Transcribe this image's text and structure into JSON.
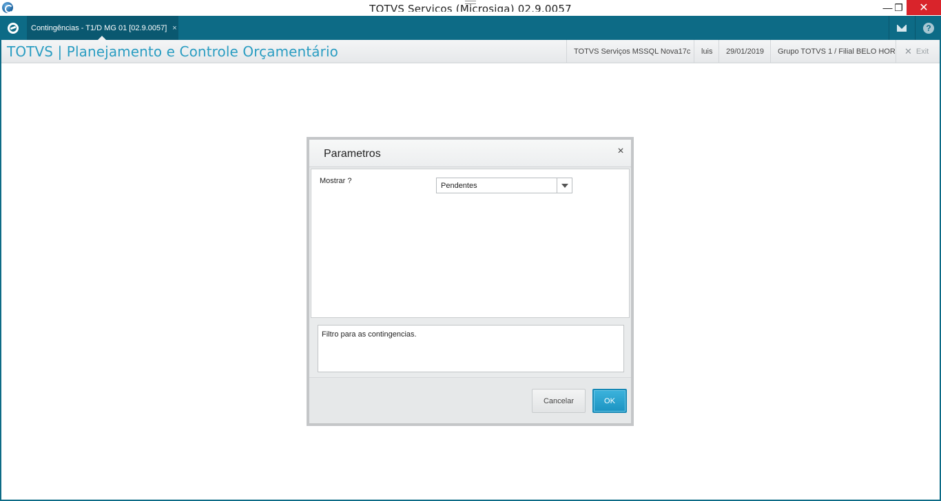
{
  "window": {
    "title": "TOTVS Serviços (Microsiga) 02.9.0057",
    "minimize_glyph": "—",
    "restore_glyph": "❐",
    "close_glyph": "✕"
  },
  "tabbar": {
    "tab_label": "Contingências - T1/D MG 01  [02.9.0057]",
    "tab_close": "×",
    "help_glyph": "?"
  },
  "header": {
    "app_title": "TOTVS | Planejamento e Controle Orçamentário",
    "environment": "TOTVS Serviços MSSQL Nova17c",
    "user": "luis",
    "date": "29/01/2019",
    "company": "Grupo TOTVS 1 / Filial BELO HOR",
    "exit_glyph": "✕",
    "exit_label": "Exit"
  },
  "dialog": {
    "title": "Parametros",
    "close_glyph": "×",
    "fields": [
      {
        "label": "Mostrar ?",
        "value": "Pendentes"
      }
    ],
    "help_text": "Filtro para as contingencias.",
    "cancel_label": "Cancelar",
    "ok_label": "OK"
  },
  "colors": {
    "accent": "#0d6b86",
    "title_blue": "#2a9dc2",
    "ok_button": "#1b93c2",
    "close_red": "#d9242b"
  }
}
